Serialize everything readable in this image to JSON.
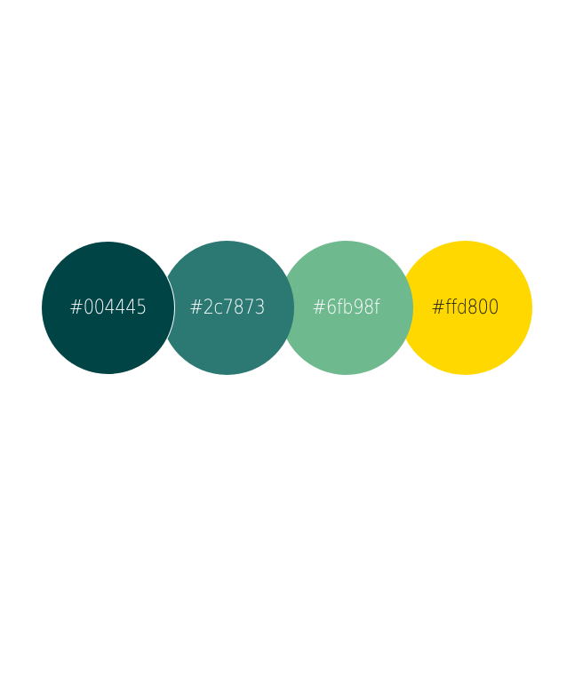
{
  "swatches": [
    {
      "label": "#004445",
      "color": "#004445",
      "text_color": "#ffffff"
    },
    {
      "label": "#2c7873",
      "color": "#2c7873",
      "text_color": "#ffffff"
    },
    {
      "label": "#6fb98f",
      "color": "#6fb98f",
      "text_color": "#ffffff"
    },
    {
      "label": "#ffd800",
      "color": "#ffd800",
      "text_color": "#1a1a1a"
    }
  ]
}
